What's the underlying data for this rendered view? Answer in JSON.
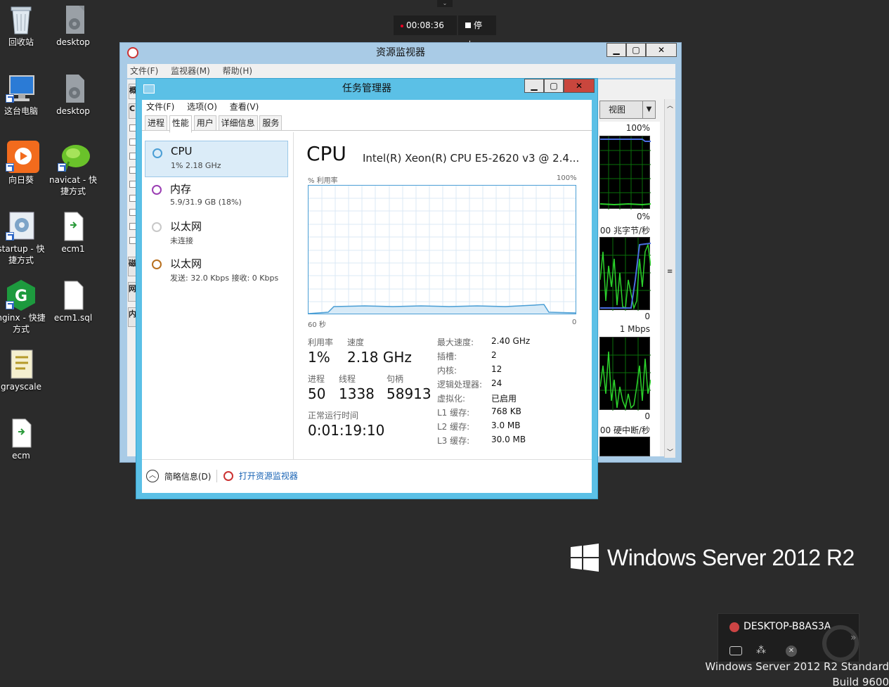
{
  "desktop": {
    "icons": [
      {
        "label": "回收站"
      },
      {
        "label": "desktop"
      },
      {
        "label": "这台电脑"
      },
      {
        "label": "desktop"
      },
      {
        "label": "向日葵"
      },
      {
        "label": "navicat - 快捷方式"
      },
      {
        "label": "startup - 快捷方式"
      },
      {
        "label": "ecm1"
      },
      {
        "label": "nginx - 快捷方式"
      },
      {
        "label": "ecm1.sql"
      },
      {
        "label": "grayscale"
      },
      {
        "label": "ecm"
      }
    ],
    "branding": {
      "text": "Windows Server 2012 R2"
    },
    "watermark": {
      "line1": "Windows Server 2012 R2 Standard",
      "line2": "Build 9600"
    }
  },
  "recording": {
    "time": "00:08:36",
    "stop_label": "停止"
  },
  "resource_monitor": {
    "title": "资源监视器",
    "menu": [
      "文件(F)",
      "监视器(M)",
      "帮助(H)"
    ],
    "view_label": "视图",
    "graphs": [
      {
        "top": "100%",
        "bottom": "0%"
      },
      {
        "top": "00 兆字节/秒",
        "bottom": "0"
      },
      {
        "top": "1 Mbps",
        "bottom": "0"
      },
      {
        "top": "00 硬中断/秒"
      }
    ]
  },
  "task_manager": {
    "title": "任务管理器",
    "menu": [
      "文件(F)",
      "选项(O)",
      "查看(V)"
    ],
    "tabs": [
      "进程",
      "性能",
      "用户",
      "详细信息",
      "服务"
    ],
    "sidebar": [
      {
        "name": "CPU",
        "sub": "1%  2.18 GHz",
        "color": "#4a9ed5"
      },
      {
        "name": "内存",
        "sub": "5.9/31.9 GB (18%)",
        "color": "#9b3fb3"
      },
      {
        "name": "以太网",
        "sub": "未连接",
        "color": "#bbbbbb"
      },
      {
        "name": "以太网",
        "sub": "发送: 32.0 Kbps  接收: 0 Kbps",
        "color": "#b8701f"
      }
    ],
    "cpu": {
      "heading": "CPU",
      "model": "Intel(R) Xeon(R) CPU E5-2620 v3 @ 2.4...",
      "graph_label": "% 利用率",
      "graph_max": "100%",
      "graph_time": "60 秒",
      "graph_zero": "0",
      "utilization_label": "利用率",
      "utilization": "1%",
      "speed_label": "速度",
      "speed": "2.18 GHz",
      "processes_label": "进程",
      "processes": "50",
      "threads_label": "线程",
      "threads": "1338",
      "handles_label": "句柄",
      "handles": "58913",
      "uptime_label": "正常运行时间",
      "uptime": "0:01:19:10",
      "details": [
        {
          "k": "最大速度:",
          "v": "2.40 GHz"
        },
        {
          "k": "插槽:",
          "v": "2"
        },
        {
          "k": "内核:",
          "v": "12"
        },
        {
          "k": "逻辑处理器:",
          "v": "24"
        },
        {
          "k": "虚拟化:",
          "v": "已启用"
        },
        {
          "k": "L1 缓存:",
          "v": "768 KB"
        },
        {
          "k": "L2 缓存:",
          "v": "3.0 MB"
        },
        {
          "k": "L3 缓存:",
          "v": "30.0 MB"
        }
      ]
    },
    "footer": {
      "fewer": "简略信息(D)",
      "open_monitor": "打开资源监视器"
    }
  },
  "notification": {
    "name": "DESKTOP-B8AS3A..."
  }
}
